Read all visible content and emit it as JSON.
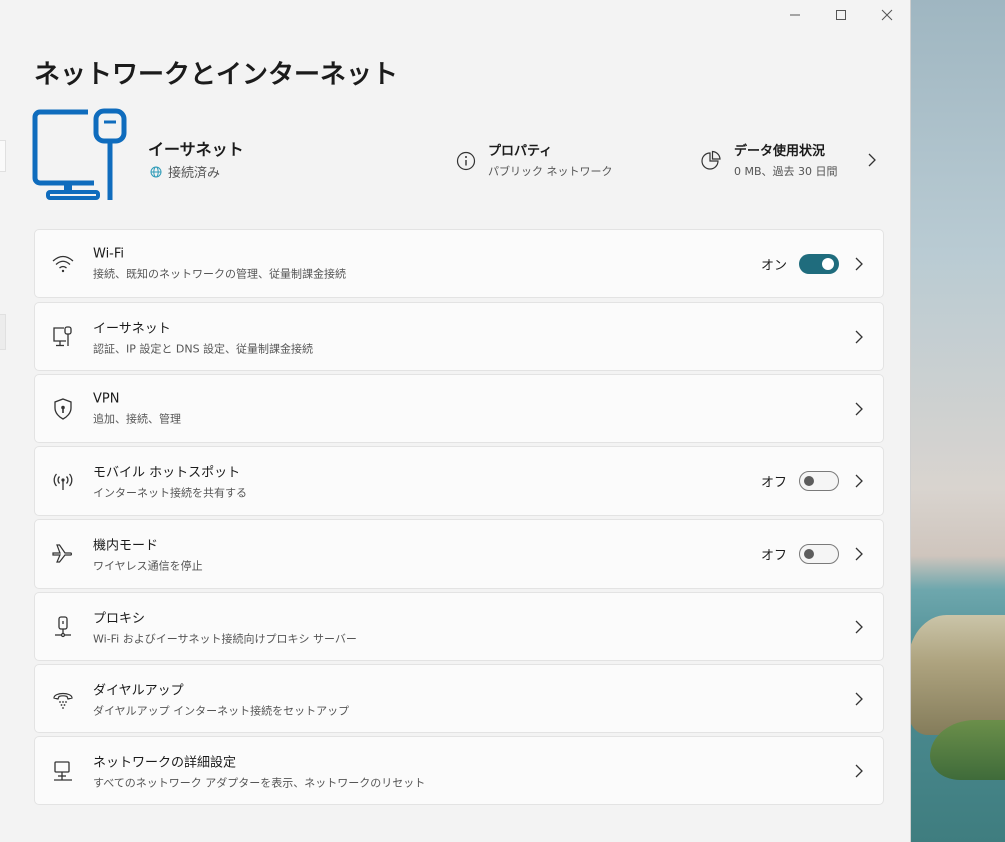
{
  "page": {
    "title": "ネットワークとインターネット"
  },
  "hero": {
    "adapter_name": "イーサネット",
    "status": "接続済み",
    "properties": {
      "title": "プロパティ",
      "subtitle": "パブリック ネットワーク"
    },
    "data_usage": {
      "title": "データ使用状況",
      "subtitle": "0 MB、過去 30 日間"
    }
  },
  "items": [
    {
      "icon": "wifi-icon",
      "title": "Wi-Fi",
      "subtitle": "接続、既知のネットワークの管理、従量制課金接続",
      "state": "オン",
      "toggle": "on"
    },
    {
      "icon": "ethernet-icon",
      "title": "イーサネット",
      "subtitle": "認証、IP 設定と DNS 設定、従量制課金接続"
    },
    {
      "icon": "vpn-shield-icon",
      "title": "VPN",
      "subtitle": "追加、接続、管理"
    },
    {
      "icon": "hotspot-icon",
      "title": "モバイル ホットスポット",
      "subtitle": "インターネット接続を共有する",
      "state": "オフ",
      "toggle": "off"
    },
    {
      "icon": "airplane-icon",
      "title": "機内モード",
      "subtitle": "ワイヤレス通信を停止",
      "state": "オフ",
      "toggle": "off"
    },
    {
      "icon": "proxy-icon",
      "title": "プロキシ",
      "subtitle": "Wi-Fi およびイーサネット接続向けプロキシ サーバー"
    },
    {
      "icon": "dialup-icon",
      "title": "ダイヤルアップ",
      "subtitle": "ダイヤルアップ インターネット接続をセットアップ"
    },
    {
      "icon": "advanced-network-icon",
      "title": "ネットワークの詳細設定",
      "subtitle": "すべてのネットワーク アダプターを表示、ネットワークのリセット"
    }
  ],
  "colors": {
    "accent": "#1f6c7d",
    "hero_icon": "#0f6cbd",
    "status_globe": "#2e9bb8"
  }
}
